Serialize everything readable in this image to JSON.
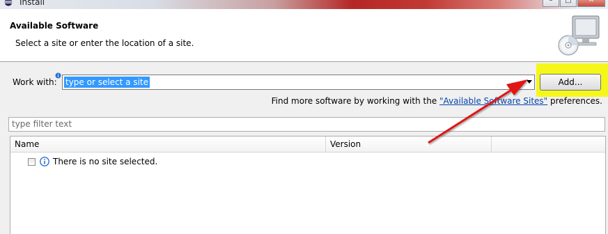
{
  "window": {
    "title": "Install",
    "controls": {
      "minimize": "–",
      "maximize": "□",
      "close": "✕"
    }
  },
  "header": {
    "title": "Available Software",
    "description": "Select a site or enter the location of a site."
  },
  "work_with": {
    "label": "Work with:",
    "value": "type or select a site"
  },
  "add_button": {
    "label": "Add..."
  },
  "find_more": {
    "prefix": "Find more software by working with the ",
    "link": "\"Available Software Sites\"",
    "suffix": " preferences."
  },
  "filter": {
    "placeholder": "type filter text"
  },
  "table": {
    "columns": [
      "Name",
      "Version",
      ""
    ],
    "rows": [
      {
        "name": "There is no site selected.",
        "checked": false
      }
    ]
  },
  "icons": {
    "app": "eclipse-icon",
    "header_image": "monitor-cd-icon",
    "info": "info-icon",
    "dropdown": "chevron-down-icon"
  },
  "colors": {
    "highlight": "#f5f71a",
    "selection": "#3399ff",
    "annotation_arrow": "#e01818",
    "link": "#0645ad"
  }
}
